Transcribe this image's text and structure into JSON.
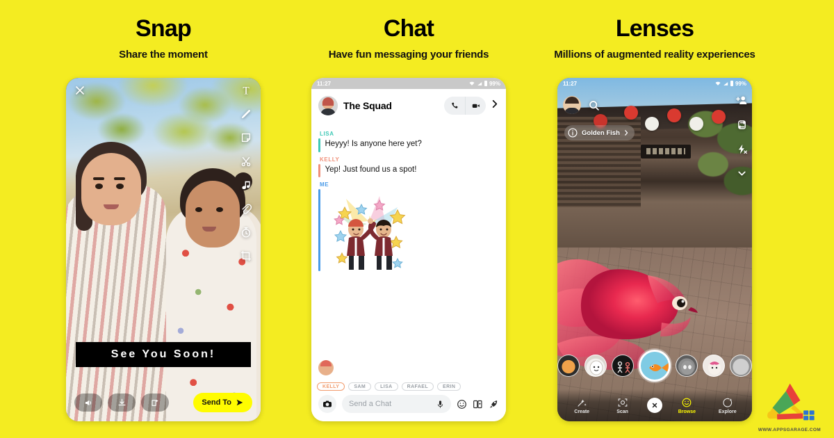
{
  "background_color": "#F4EC21",
  "columns": [
    {
      "id": "snap",
      "title": "Snap",
      "subtitle": "Share the moment"
    },
    {
      "id": "chat",
      "title": "Chat",
      "subtitle": "Have fun messaging your friends"
    },
    {
      "id": "lenses",
      "title": "Lenses",
      "subtitle": "Millions of augmented reality experiences"
    }
  ],
  "snap_screen": {
    "close_icon": "close-icon",
    "tools": [
      {
        "icon": "text-tool-icon",
        "label": "T"
      },
      {
        "icon": "draw-pen-icon",
        "label": "Draw"
      },
      {
        "icon": "sticker-icon",
        "label": "Stickers"
      },
      {
        "icon": "scissors-icon",
        "label": "Scissors"
      },
      {
        "icon": "music-note-icon",
        "label": "Music"
      },
      {
        "icon": "paperclip-icon",
        "label": "Attach link"
      },
      {
        "icon": "timer-icon",
        "label": "Timer"
      },
      {
        "icon": "crop-icon",
        "label": "Crop"
      }
    ],
    "caption": "See You Soon!",
    "bottom_actions": [
      {
        "icon": "volume-icon",
        "label": "Sound"
      },
      {
        "icon": "download-icon",
        "label": "Save"
      },
      {
        "icon": "add-story-icon",
        "label": "Add to Story"
      }
    ],
    "send_to_label": "Send To",
    "send_to_icon": "send-arrow-icon",
    "send_to_color": "#FFFC00"
  },
  "chat_screen": {
    "status_bar": {
      "time": "11:27",
      "battery": "99%",
      "wifi_icon": "wifi-icon",
      "signal_icon": "signal-icon",
      "battery_icon": "battery-icon"
    },
    "header": {
      "avatar": "group-avatar",
      "title": "The Squad",
      "call_icon": "phone-call-icon",
      "video_icon": "video-camera-icon",
      "chevron_icon": "chevron-right-icon"
    },
    "messages": [
      {
        "sender": "LISA",
        "color": "#3FC9B6",
        "text": "Heyyy! Is anyone here yet?",
        "type": "text"
      },
      {
        "sender": "KELLY",
        "color": "#F0907A",
        "text": "Yep! Just found us a spot!",
        "type": "text"
      },
      {
        "sender": "ME",
        "color": "#4A9BE8",
        "text": "",
        "type": "sticker",
        "sticker": "bitmoji-high-five-sticker"
      }
    ],
    "friend_chips": [
      {
        "label": "KELLY",
        "active": true
      },
      {
        "label": "SAM",
        "active": false
      },
      {
        "label": "LISA",
        "active": false
      },
      {
        "label": "RAFAEL",
        "active": false
      },
      {
        "label": "ERIN",
        "active": false
      }
    ],
    "input": {
      "camera_icon": "camera-icon",
      "placeholder": "Send a Chat",
      "mic_icon": "microphone-icon",
      "emoji_icon": "emoji-icon",
      "sticker_icon": "sticker-card-icon",
      "rocket_icon": "rocket-icon"
    }
  },
  "lenses_screen": {
    "status_bar": {
      "time": "11:27",
      "battery": "99%",
      "wifi_icon": "wifi-icon",
      "signal_icon": "signal-icon",
      "battery_icon": "battery-icon"
    },
    "avatar": "profile-avatar",
    "search_icon": "search-icon",
    "right_icons": [
      {
        "icon": "add-friend-icon",
        "label": "Add Friends"
      },
      {
        "icon": "flip-camera-icon",
        "label": "Flip Camera"
      },
      {
        "icon": "flash-off-icon",
        "label": "Flash Off"
      },
      {
        "icon": "chevron-down-icon",
        "label": "More"
      }
    ],
    "lens_label": {
      "info_icon": "info-icon",
      "name": "Golden Fish",
      "chevron_icon": "chevron-right-icon"
    },
    "carousel": [
      {
        "name": "lens-thumb-1",
        "selected": false
      },
      {
        "name": "lens-thumb-2",
        "selected": false
      },
      {
        "name": "lens-thumb-3",
        "selected": false
      },
      {
        "name": "golden-fish-lens",
        "selected": true
      },
      {
        "name": "lens-thumb-5",
        "selected": false
      },
      {
        "name": "lens-thumb-6",
        "selected": false
      },
      {
        "name": "lens-thumb-7",
        "selected": false
      }
    ],
    "nav": [
      {
        "label": "Create",
        "icon": "create-icon",
        "active": false
      },
      {
        "label": "Scan",
        "icon": "scan-icon",
        "active": false
      },
      {
        "label": "Browse",
        "icon": "browse-smiley-icon",
        "active": true
      },
      {
        "label": "Explore",
        "icon": "explore-icon",
        "active": false
      }
    ],
    "close_icon": "close-icon",
    "active_color": "#FFFC00"
  },
  "watermark": {
    "logo": "appsgarage-logo",
    "url": "WWW.APPSGARAGE.COM"
  }
}
